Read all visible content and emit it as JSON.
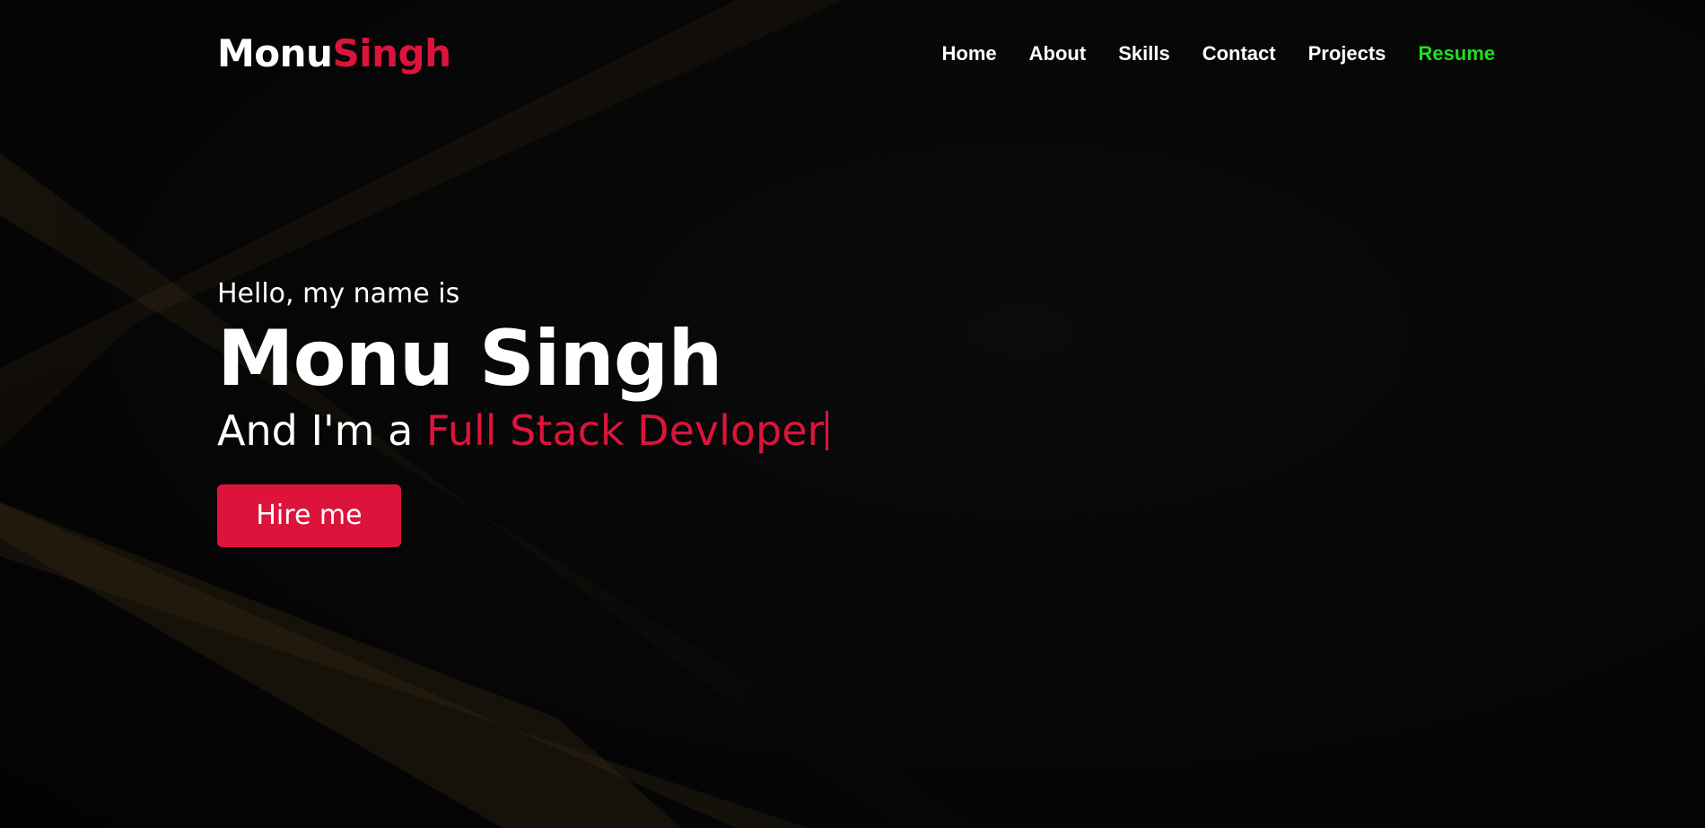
{
  "logo": {
    "part1": "Monu",
    "part2": "Singh"
  },
  "nav": {
    "items": [
      {
        "label": "Home"
      },
      {
        "label": "About"
      },
      {
        "label": "Skills"
      },
      {
        "label": "Contact"
      },
      {
        "label": "Projects"
      },
      {
        "label": "Resume"
      }
    ]
  },
  "hero": {
    "greeting": "Hello, my name is",
    "name": "Monu Singh",
    "role_prefix": "And I'm a ",
    "role_typed": "Full Stack Devloper",
    "cta_label": "Hire me"
  },
  "colors": {
    "accent": "#dc143c",
    "resume": "#1ee01e",
    "background": "#050505",
    "text": "#ffffff"
  }
}
